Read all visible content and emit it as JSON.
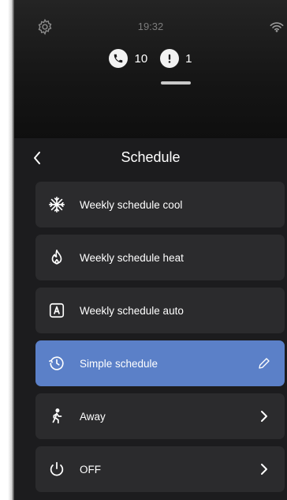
{
  "status_bar": {
    "time": "19:32",
    "settings_icon": "gear-icon",
    "wifi_icon": "wifi-icon"
  },
  "notifications": {
    "calls_count": "10",
    "alerts_count": "1"
  },
  "screen": {
    "title": "Schedule",
    "back_icon": "chevron-left-icon"
  },
  "menu": {
    "items": [
      {
        "label": "Weekly schedule cool",
        "icon": "snowflake-icon"
      },
      {
        "label": "Weekly schedule heat",
        "icon": "flame-icon"
      },
      {
        "label": "Weekly schedule auto",
        "icon": "auto-a-icon"
      },
      {
        "label": "Simple schedule",
        "icon": "clock-history-icon",
        "trailing_icon": "pencil-icon",
        "selected": true
      },
      {
        "label": "Away",
        "icon": "walking-person-icon",
        "trailing_icon": "chevron-right-icon"
      },
      {
        "label": "OFF",
        "icon": "power-icon",
        "trailing_icon": "chevron-right-icon"
      }
    ]
  },
  "colors": {
    "background": "#1c1c1e",
    "item_background": "#2b2b2d",
    "selected_background": "#5b80c8",
    "text": "#ffffff"
  }
}
